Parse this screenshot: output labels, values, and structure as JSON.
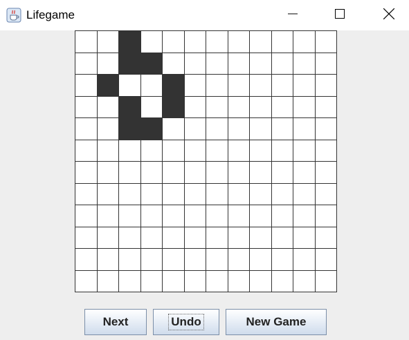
{
  "window": {
    "title": "Lifegame",
    "icon": "java-cup-icon",
    "controls": [
      "minimize-icon",
      "maximize-icon",
      "close-icon"
    ]
  },
  "board": {
    "rows": 12,
    "cols": 12,
    "alive_cells": [
      [
        0,
        2
      ],
      [
        1,
        2
      ],
      [
        1,
        3
      ],
      [
        2,
        1
      ],
      [
        2,
        4
      ],
      [
        3,
        2
      ],
      [
        3,
        4
      ],
      [
        4,
        2
      ],
      [
        4,
        3
      ]
    ],
    "alive_color": "#333333",
    "dead_color": "#ffffff",
    "line_color": "#333333"
  },
  "buttons": {
    "next_label": "Next",
    "undo_label": "Undo",
    "new_game_label": "New Game"
  }
}
